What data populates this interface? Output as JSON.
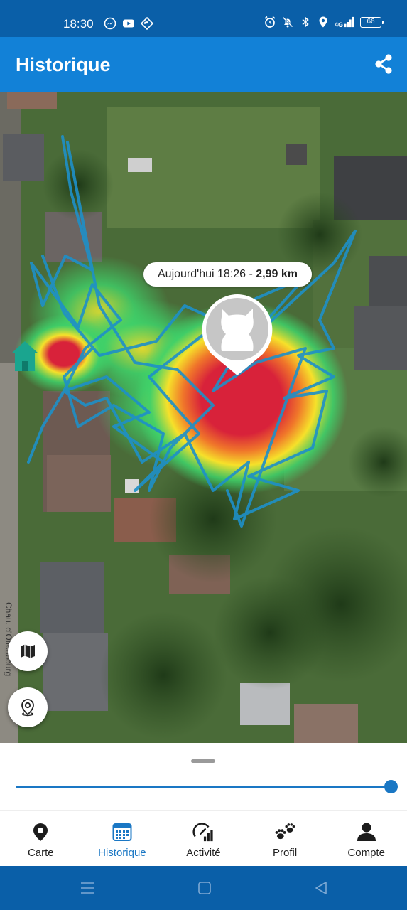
{
  "status_bar": {
    "time": "18:30",
    "network": "4G",
    "battery": "66",
    "left_icons": [
      "messenger-icon",
      "youtube-icon",
      "navigation-app-icon"
    ],
    "right_icons": [
      "alarm-icon",
      "bell-muted-icon",
      "bluetooth-icon",
      "location-icon",
      "signal-icon",
      "battery-icon"
    ]
  },
  "app_bar": {
    "title": "Historique",
    "action_icon": "share-icon"
  },
  "map": {
    "position_label_prefix": "Aujourd'hui 18:26 - ",
    "position_label_distance": "2,99 km",
    "street_label": "Chau. d'Offenbourg",
    "markers": [
      "cat-avatar-icon",
      "home-icon"
    ],
    "fab_layers_icon": "map-icon",
    "fab_locate_icon": "location-pin-icon"
  },
  "timeline": {
    "slider_value_fraction": 1.0
  },
  "bottom_nav": {
    "items": [
      {
        "label": "Carte",
        "icon": "map-pin-icon",
        "active": false
      },
      {
        "label": "Historique",
        "icon": "calendar-icon",
        "active": true
      },
      {
        "label": "Activité",
        "icon": "activity-gauge-icon",
        "active": false
      },
      {
        "label": "Profil",
        "icon": "paw-icon",
        "active": false
      },
      {
        "label": "Compte",
        "icon": "person-icon",
        "active": false
      }
    ]
  },
  "colors": {
    "primary": "#1281d7",
    "status_bar": "#0a5fa8",
    "accent": "#1a77c4",
    "heat_hot": "#d8223a",
    "heat_mid": "#f6e12a",
    "heat_low": "#3fd36a",
    "track": "#1e90c8",
    "home_marker": "#1aa58f"
  }
}
